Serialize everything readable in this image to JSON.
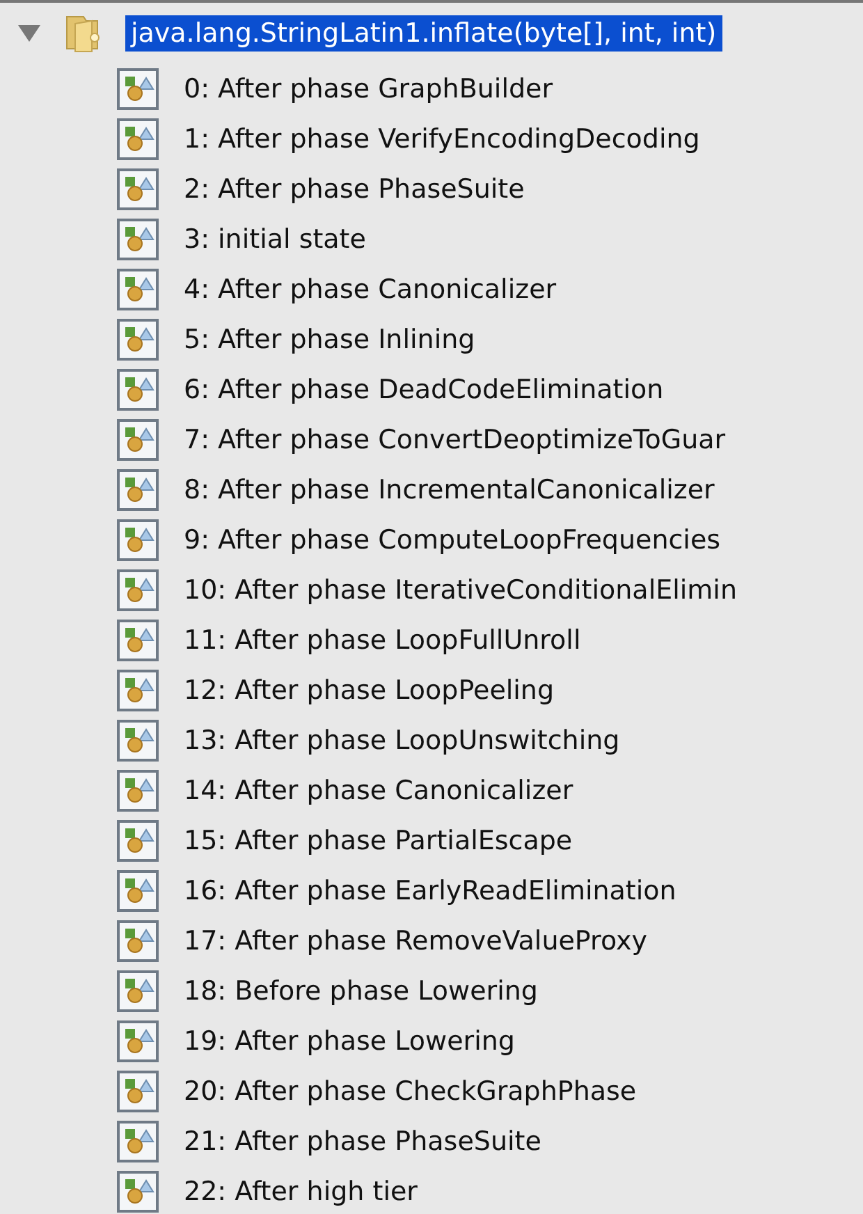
{
  "tree": {
    "label": "java.lang.StringLatin1.inflate(byte[], int, int)",
    "expanded": true,
    "selected": true,
    "children": [
      {
        "label": "0: After phase GraphBuilder",
        "selected": false
      },
      {
        "label": "1: After phase VerifyEncodingDecoding",
        "selected": false
      },
      {
        "label": "2: After phase PhaseSuite",
        "selected": false
      },
      {
        "label": "3: initial state",
        "selected": false
      },
      {
        "label": "4: After phase Canonicalizer",
        "selected": false
      },
      {
        "label": "5: After phase Inlining",
        "selected": false
      },
      {
        "label": "6: After phase DeadCodeElimination",
        "selected": false
      },
      {
        "label": "7: After phase ConvertDeoptimizeToGuar",
        "selected": false
      },
      {
        "label": "8: After phase IncrementalCanonicalizer",
        "selected": false
      },
      {
        "label": "9: After phase ComputeLoopFrequencies",
        "selected": false
      },
      {
        "label": "10: After phase IterativeConditionalElimin",
        "selected": false
      },
      {
        "label": "11: After phase LoopFullUnroll",
        "selected": false
      },
      {
        "label": "12: After phase LoopPeeling",
        "selected": false
      },
      {
        "label": "13: After phase LoopUnswitching",
        "selected": false
      },
      {
        "label": "14: After phase Canonicalizer",
        "selected": false
      },
      {
        "label": "15: After phase PartialEscape",
        "selected": false
      },
      {
        "label": "16: After phase EarlyReadElimination",
        "selected": false
      },
      {
        "label": "17: After phase RemoveValueProxy",
        "selected": false
      },
      {
        "label": "18: Before phase Lowering",
        "selected": false
      },
      {
        "label": "19: After phase Lowering",
        "selected": false
      },
      {
        "label": "20: After phase CheckGraphPhase",
        "selected": false
      },
      {
        "label": "21: After phase PhaseSuite",
        "selected": false
      },
      {
        "label": "22: After high tier",
        "selected": false
      }
    ]
  }
}
